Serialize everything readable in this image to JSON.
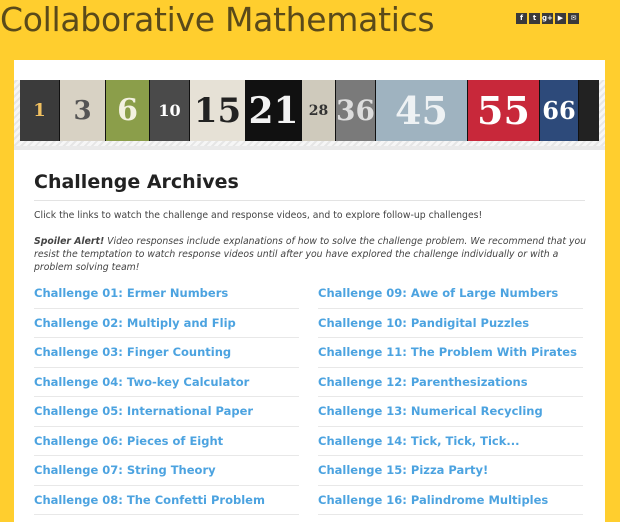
{
  "site": {
    "title": "Collaborative Mathematics"
  },
  "social": [
    {
      "icon": "facebook-icon",
      "glyph": "f"
    },
    {
      "icon": "twitter-icon",
      "glyph": "t"
    },
    {
      "icon": "google-plus-icon",
      "glyph": "g+"
    },
    {
      "icon": "youtube-icon",
      "glyph": "▶"
    },
    {
      "icon": "email-icon",
      "glyph": "✉"
    }
  ],
  "banner": {
    "numbers": [
      "1",
      "3",
      "6",
      "10",
      "15",
      "21",
      "28",
      "36",
      "45",
      "55",
      "66"
    ]
  },
  "page": {
    "title": "Challenge Archives",
    "intro": "Click the links to watch the challenge and response videos, and to explore follow-up challenges!",
    "spoiler_label": "Spoiler Alert!",
    "spoiler_text": " Video responses include explanations of how to solve the challenge problem. We recommend that you resist the temptation to watch response videos until after you have explored the challenge individually or with a problem solving team!"
  },
  "challenges_left": [
    "Challenge 01: Ermer Numbers",
    "Challenge 02: Multiply and Flip",
    "Challenge 03: Finger Counting",
    "Challenge 04: Two-key Calculator",
    "Challenge 05: International Paper",
    "Challenge 06: Pieces of Eight",
    "Challenge 07: String Theory",
    "Challenge 08: The Confetti Problem"
  ],
  "challenges_right": [
    "Challenge 09: Awe of Large Numbers",
    "Challenge 10: Pandigital Puzzles",
    "Challenge 11: The Problem With Pirates",
    "Challenge 12: Parenthesizations",
    "Challenge 13: Numerical Recycling",
    "Challenge 14: Tick, Tick, Tick...",
    "Challenge 15: Pizza Party!",
    "Challenge 16: Palindrome Multiples"
  ],
  "colors": {
    "background": "#ffce2e",
    "link": "#4ca3e0",
    "title": "#5a4a1a"
  }
}
